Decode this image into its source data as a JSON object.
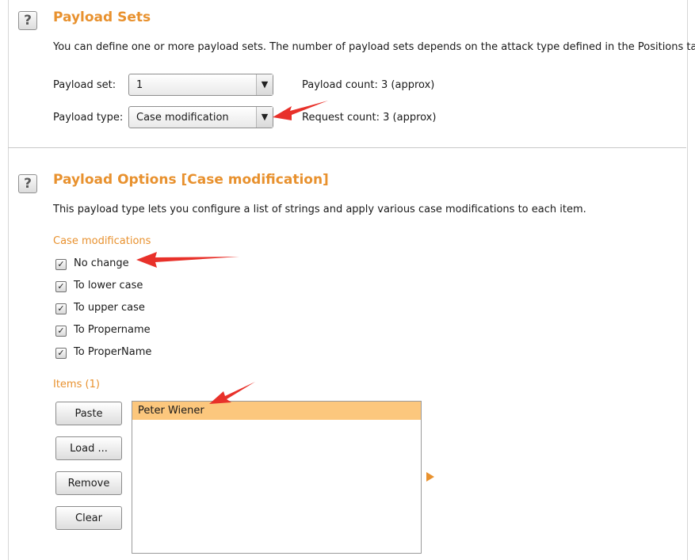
{
  "payload_sets": {
    "help_glyph": "?",
    "title": "Payload Sets",
    "description": "You can define one or more payload sets. The number of payload sets depends on the attack type defined in the Positions ta",
    "set_label": "Payload set:",
    "set_value": "1",
    "type_label": "Payload type:",
    "type_value": "Case modification",
    "payload_count": "Payload count:  3 (approx)",
    "request_count": "Request count:  3 (approx)"
  },
  "payload_options": {
    "help_glyph": "?",
    "title": "Payload Options [Case modification]",
    "description": "This payload type lets you configure a list of strings and apply various case modifications to each item.",
    "case_heading": "Case modifications",
    "checkboxes": [
      {
        "label": "No change",
        "checked": true
      },
      {
        "label": "To lower case",
        "checked": true
      },
      {
        "label": "To upper case",
        "checked": true
      },
      {
        "label": "To Propername",
        "checked": true
      },
      {
        "label": "To ProperName",
        "checked": true
      }
    ],
    "check_glyph": "✓",
    "items_heading": "Items (1)",
    "buttons": {
      "paste": "Paste",
      "load": "Load ...",
      "remove": "Remove",
      "clear": "Clear"
    },
    "items": [
      "Peter Wiener"
    ]
  },
  "icons": {
    "help": "help-icon",
    "dropdown": "chevron-down-icon",
    "expand": "triangle-right-icon",
    "annotation": "red-arrow-annotation"
  },
  "colors": {
    "accent": "#e8912e",
    "selection": "#fcc77d",
    "annotation": "#e8312a"
  }
}
